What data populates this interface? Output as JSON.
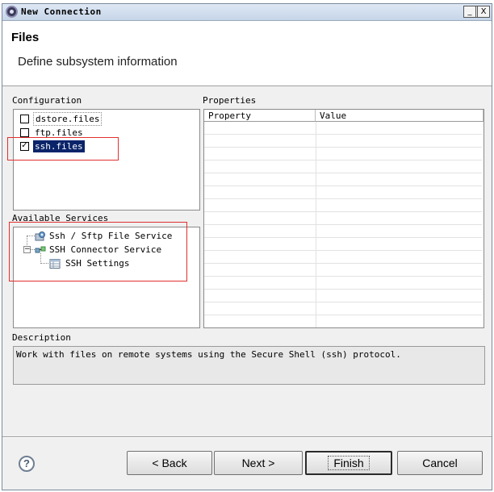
{
  "window": {
    "title": "New Connection",
    "controls": {
      "minimize": "_",
      "maximize": "□",
      "close": "X"
    }
  },
  "header": {
    "title": "Files",
    "subtitle": "Define subsystem information"
  },
  "configuration": {
    "label": "Configuration",
    "items": [
      {
        "label": "dstore.files",
        "checked": false,
        "selected": false
      },
      {
        "label": "ftp.files",
        "checked": false,
        "selected": false
      },
      {
        "label": "ssh.files",
        "checked": true,
        "selected": true
      }
    ]
  },
  "services": {
    "label": "Available Services",
    "tree": [
      {
        "label": "Ssh / Sftp File Service",
        "icon": "file-service-icon"
      },
      {
        "label": "SSH Connector Service",
        "icon": "connector-service-icon",
        "expanded": true
      },
      {
        "label": "SSH Settings",
        "icon": "settings-table-icon"
      }
    ]
  },
  "properties": {
    "label": "Properties",
    "columns": [
      "Property",
      "Value"
    ],
    "rows": []
  },
  "description": {
    "label": "Description",
    "text": "Work with files on remote systems using the Secure Shell (ssh) protocol."
  },
  "buttons": {
    "help": "?",
    "back": "< Back",
    "next": "Next >",
    "finish": "Finish",
    "cancel": "Cancel"
  },
  "colors": {
    "selection": "#0a246a",
    "annotation_box": "#e0302e"
  }
}
